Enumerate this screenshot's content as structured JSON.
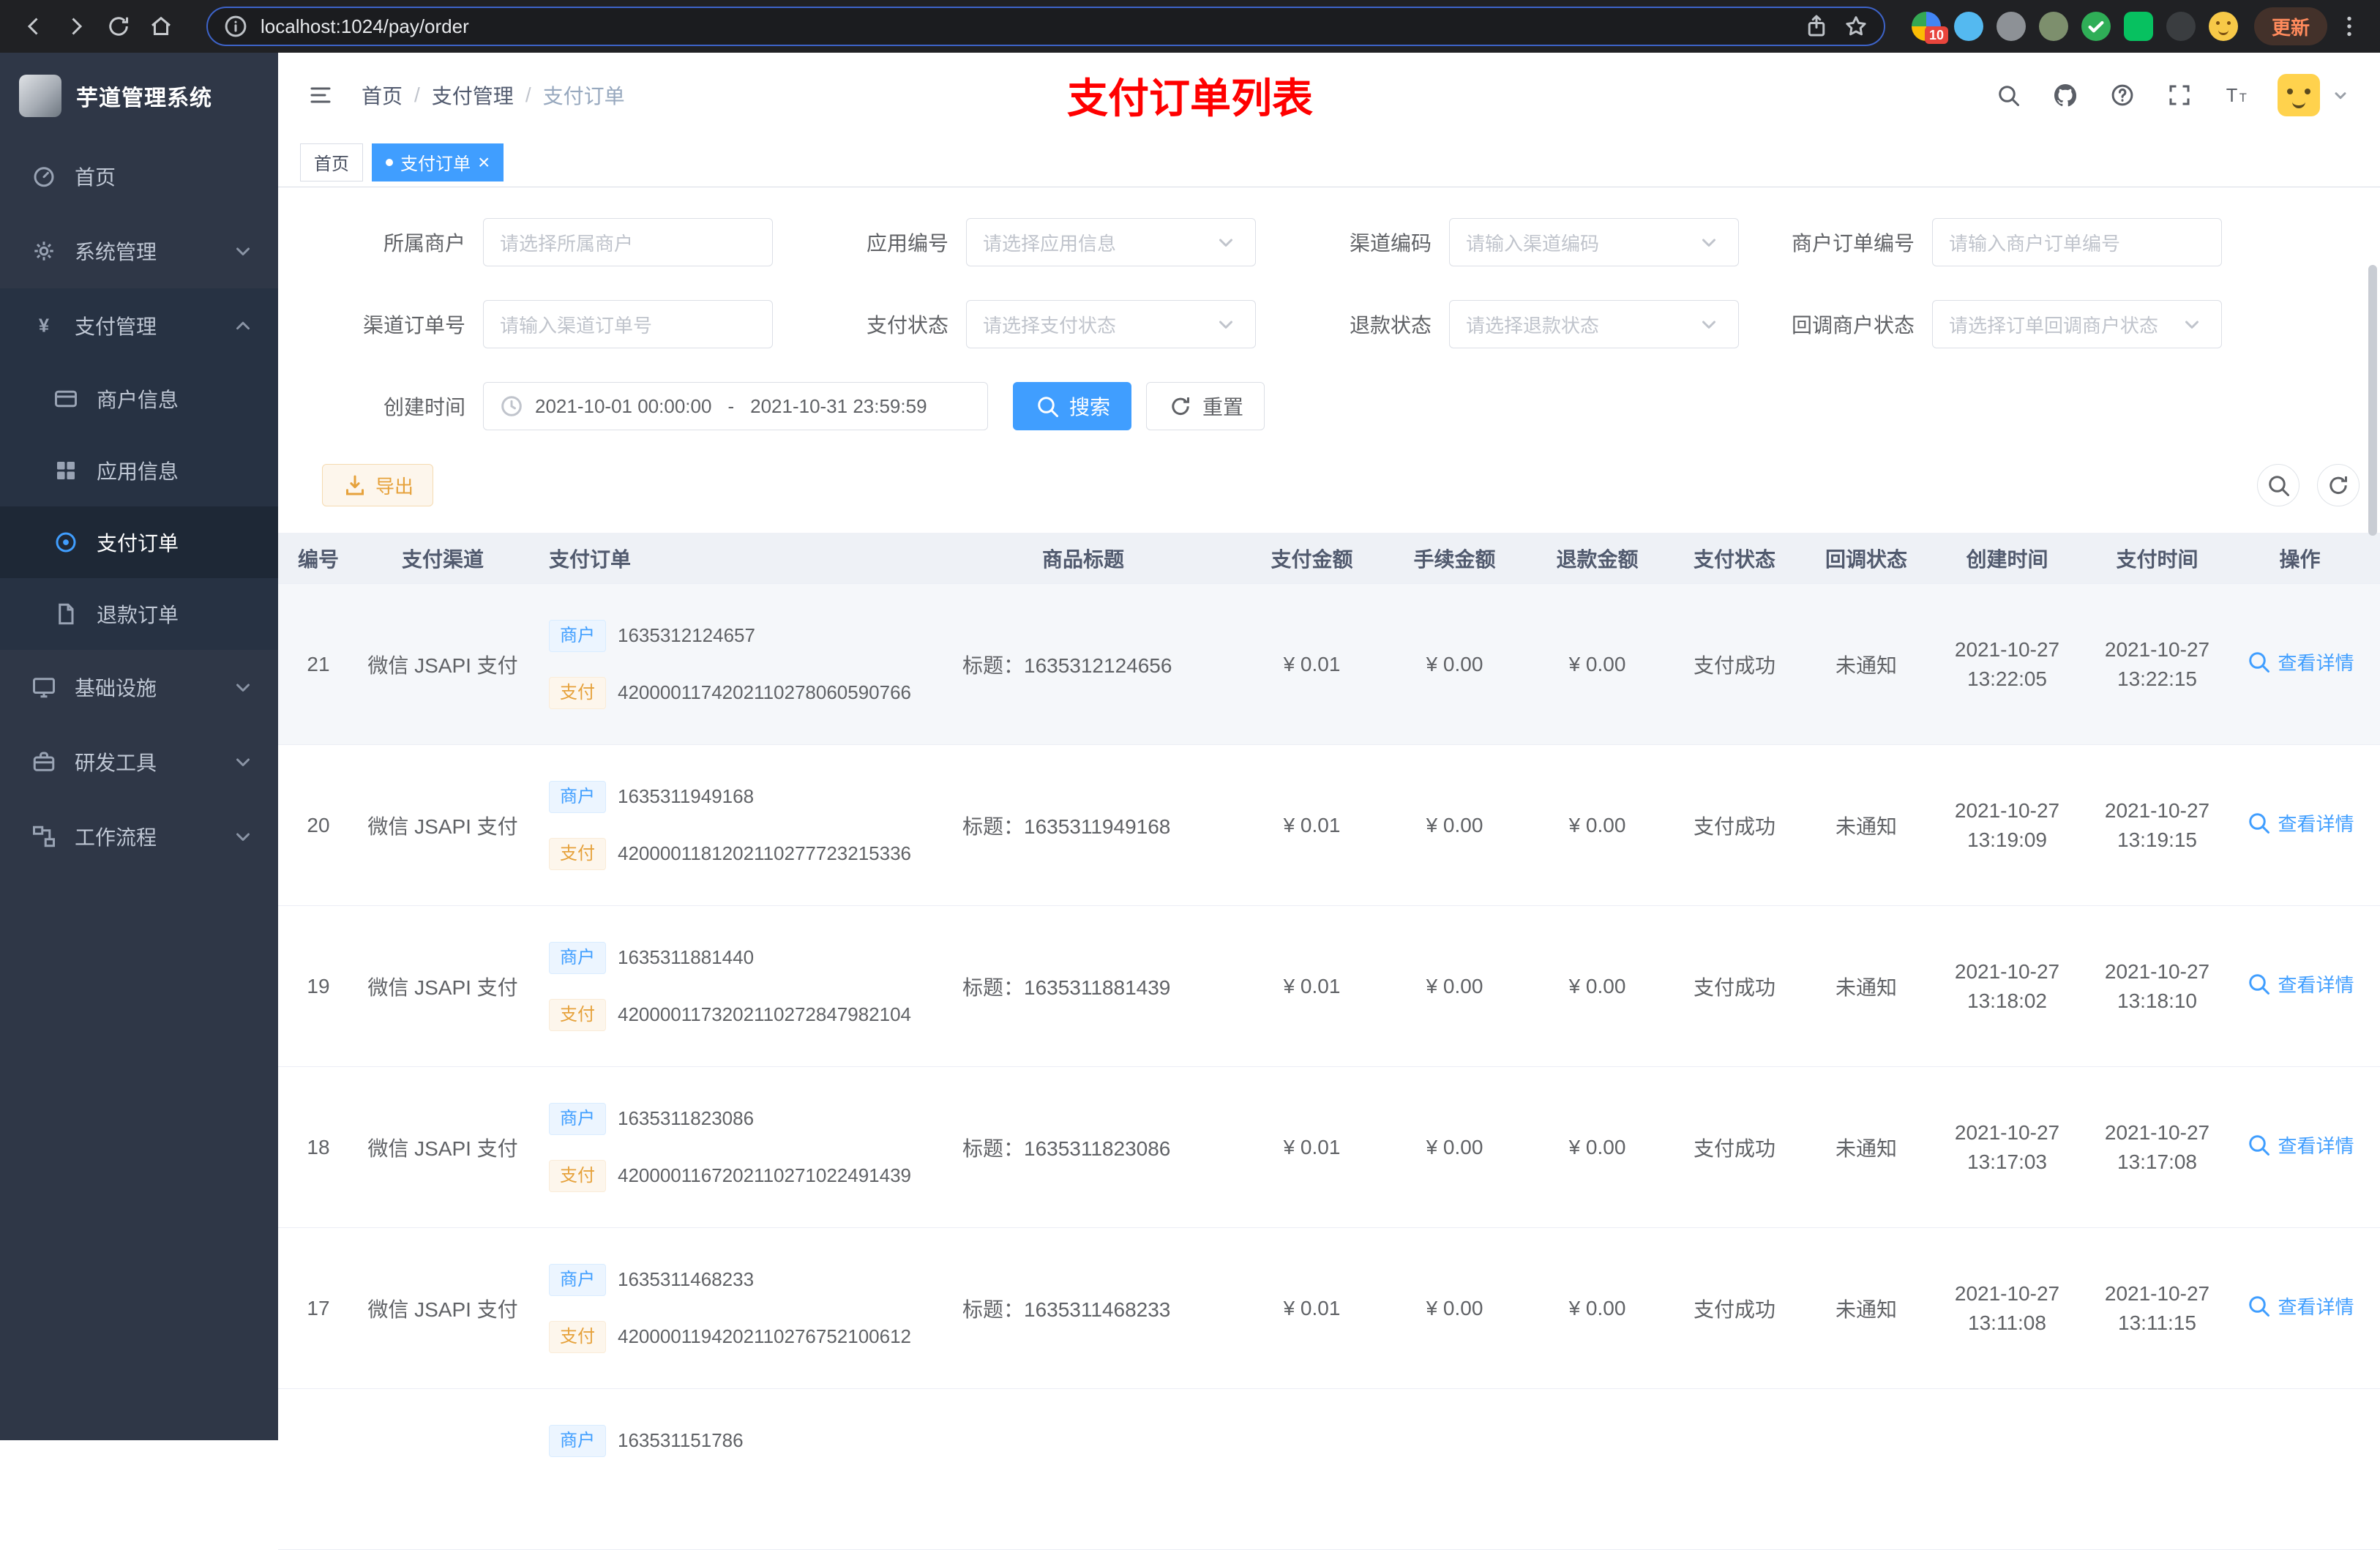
{
  "colors": {
    "accent": "#409eff",
    "warning": "#e6a23c",
    "title_red": "#ff0000",
    "active_tab": "#409eff"
  },
  "chrome": {
    "url": "localhost:1024/pay/order",
    "update_label": "更新",
    "extensions": [
      {
        "name": "extension-colorful-icon",
        "color": "#4285f4",
        "badge": "10"
      },
      {
        "name": "extension-blue-icon",
        "color": "#54b9f0"
      },
      {
        "name": "extension-gray-icon",
        "color": "#8d9196"
      },
      {
        "name": "extension-olive-icon",
        "color": "#7d8f6d"
      },
      {
        "name": "extension-green-check-icon",
        "color": "#2fae57"
      },
      {
        "name": "extension-wechat-icon",
        "color": "#07c160",
        "shape": "square"
      },
      {
        "name": "extension-dark-icon",
        "color": "#3a3d40"
      },
      {
        "name": "extension-emoji-icon",
        "color": "#f7c948"
      }
    ]
  },
  "sidebar": {
    "logo_title": "芋道管理系统",
    "items": [
      {
        "key": "home",
        "label": "首页",
        "icon": "dashboard",
        "level": 1
      },
      {
        "key": "system",
        "label": "系统管理",
        "icon": "gear",
        "level": 1,
        "chevron": "down"
      },
      {
        "key": "payment",
        "label": "支付管理",
        "icon": "yen",
        "level": 1,
        "chevron": "up",
        "expanded": true
      },
      {
        "key": "merchant-info",
        "label": "商户信息",
        "icon": "card",
        "level": 2
      },
      {
        "key": "app-info",
        "label": "应用信息",
        "icon": "grid",
        "level": 2
      },
      {
        "key": "pay-order",
        "label": "支付订单",
        "icon": "target",
        "level": 2,
        "active": true
      },
      {
        "key": "refund-order",
        "label": "退款订单",
        "icon": "doc",
        "level": 2
      },
      {
        "key": "infrastructure",
        "label": "基础设施",
        "icon": "monitor",
        "level": 1,
        "chevron": "down"
      },
      {
        "key": "devtools",
        "label": "研发工具",
        "icon": "toolbox",
        "level": 1,
        "chevron": "down"
      },
      {
        "key": "workflow",
        "label": "工作流程",
        "icon": "workflow",
        "level": 1,
        "chevron": "down"
      }
    ]
  },
  "header": {
    "breadcrumb": [
      "首页",
      "支付管理",
      "支付订单"
    ],
    "separator": "/",
    "page_title": "支付订单列表"
  },
  "tabs": [
    {
      "label": "首页",
      "active": false,
      "closable": false
    },
    {
      "label": "支付订单",
      "active": true,
      "closable": true
    }
  ],
  "filters": {
    "fields": [
      {
        "key": "merchant",
        "label": "所属商户",
        "placeholder": "请选择所属商户",
        "type": "input"
      },
      {
        "key": "app-no",
        "label": "应用编号",
        "placeholder": "请选择应用信息",
        "type": "select"
      },
      {
        "key": "channel-code",
        "label": "渠道编码",
        "placeholder": "请输入渠道编码",
        "type": "select"
      },
      {
        "key": "merchant-order-no",
        "label": "商户订单编号",
        "placeholder": "请输入商户订单编号",
        "type": "input"
      },
      {
        "key": "channel-order-no",
        "label": "渠道订单号",
        "placeholder": "请输入渠道订单号",
        "type": "input"
      },
      {
        "key": "pay-status",
        "label": "支付状态",
        "placeholder": "请选择支付状态",
        "type": "select"
      },
      {
        "key": "refund-status",
        "label": "退款状态",
        "placeholder": "请选择退款状态",
        "type": "select"
      },
      {
        "key": "notify-status",
        "label": "回调商户状态",
        "placeholder": "请选择订单回调商户状态",
        "type": "select"
      }
    ],
    "date": {
      "label": "创建时间",
      "start": "2021-10-01 00:00:00",
      "end": "2021-10-31 23:59:59",
      "separator": "-"
    },
    "search_label": "搜索",
    "reset_label": "重置"
  },
  "toolbar": {
    "export_label": "导出"
  },
  "table": {
    "columns": [
      "编号",
      "支付渠道",
      "支付订单",
      "商品标题",
      "支付金额",
      "手续金额",
      "退款金额",
      "支付状态",
      "回调状态",
      "创建时间",
      "支付时间",
      "操作"
    ],
    "merchant_tag": "商户",
    "pay_tag": "支付",
    "title_prefix": "标题：",
    "action_label": "查看详情",
    "rows": [
      {
        "id": "21",
        "channel": "微信 JSAPI 支付",
        "merchant_no": "1635312124657",
        "pay_no": "4200001174202110278060590766",
        "title": "1635312124656",
        "amount": "¥ 0.01",
        "fee": "¥ 0.00",
        "refund": "¥ 0.00",
        "status": "支付成功",
        "notify": "未通知",
        "created": "2021-10-27 13:22:05",
        "paid": "2021-10-27 13:22:15",
        "highlight": true
      },
      {
        "id": "20",
        "channel": "微信 JSAPI 支付",
        "merchant_no": "1635311949168",
        "pay_no": "4200001181202110277723215336",
        "title": "1635311949168",
        "amount": "¥ 0.01",
        "fee": "¥ 0.00",
        "refund": "¥ 0.00",
        "status": "支付成功",
        "notify": "未通知",
        "created": "2021-10-27 13:19:09",
        "paid": "2021-10-27 13:19:15"
      },
      {
        "id": "19",
        "channel": "微信 JSAPI 支付",
        "merchant_no": "1635311881440",
        "pay_no": "4200001173202110272847982104",
        "title": "1635311881439",
        "amount": "¥ 0.01",
        "fee": "¥ 0.00",
        "refund": "¥ 0.00",
        "status": "支付成功",
        "notify": "未通知",
        "created": "2021-10-27 13:18:02",
        "paid": "2021-10-27 13:18:10"
      },
      {
        "id": "18",
        "channel": "微信 JSAPI 支付",
        "merchant_no": "1635311823086",
        "pay_no": "4200001167202110271022491439",
        "title": "1635311823086",
        "amount": "¥ 0.01",
        "fee": "¥ 0.00",
        "refund": "¥ 0.00",
        "status": "支付成功",
        "notify": "未通知",
        "created": "2021-10-27 13:17:03",
        "paid": "2021-10-27 13:17:08"
      },
      {
        "id": "17",
        "channel": "微信 JSAPI 支付",
        "merchant_no": "1635311468233",
        "pay_no": "4200001194202110276752100612",
        "title": "1635311468233",
        "amount": "¥ 0.01",
        "fee": "¥ 0.00",
        "refund": "¥ 0.00",
        "status": "支付成功",
        "notify": "未通知",
        "created": "2021-10-27 13:11:08",
        "paid": "2021-10-27 13:11:15"
      },
      {
        "id": "",
        "channel": "",
        "merchant_no": "163531151786",
        "pay_no": "",
        "title": "",
        "amount": "",
        "fee": "",
        "refund": "",
        "status": "",
        "notify": "",
        "created": "",
        "paid": "",
        "partial": true
      }
    ]
  }
}
